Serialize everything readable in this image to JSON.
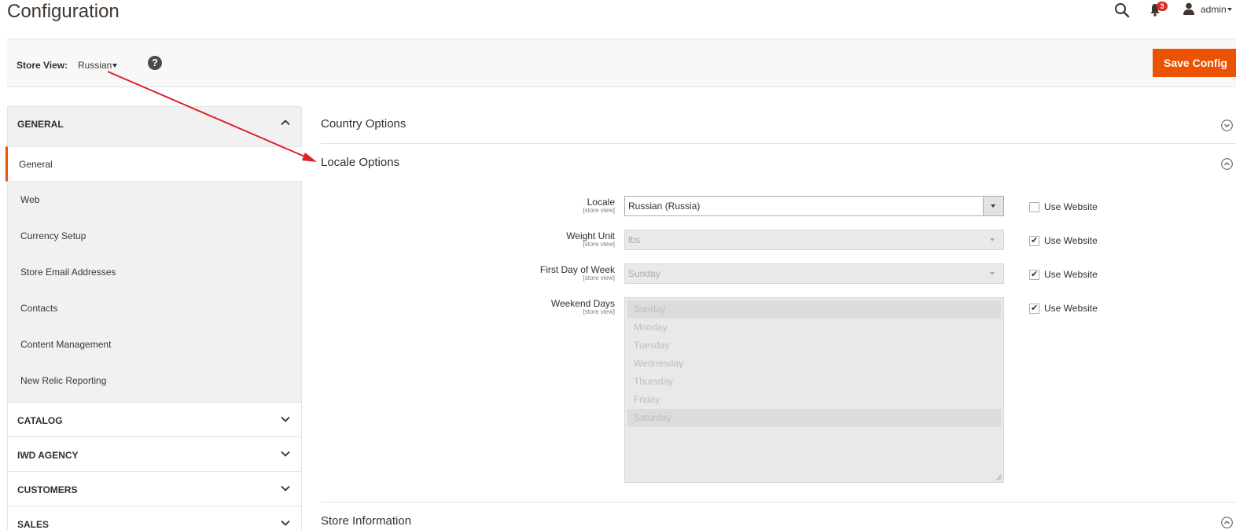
{
  "header": {
    "title": "Configuration",
    "notifications_count": "3",
    "user_name": "admin"
  },
  "store_bar": {
    "label": "Store View:",
    "selected_store": "Russian",
    "help_glyph": "?",
    "save_label": "Save Config"
  },
  "sidebar": {
    "general_section": {
      "title": "GENERAL",
      "items": [
        {
          "label": "General",
          "active": true
        },
        {
          "label": "Web"
        },
        {
          "label": "Currency Setup"
        },
        {
          "label": "Store Email Addresses"
        },
        {
          "label": "Contacts"
        },
        {
          "label": "Content Management"
        },
        {
          "label": "New Relic Reporting"
        }
      ]
    },
    "collapsed_sections": [
      "CATALOG",
      "IWD AGENCY",
      "CUSTOMERS",
      "SALES"
    ]
  },
  "main": {
    "groups": [
      {
        "title": "Country Options",
        "expanded": false
      },
      {
        "title": "Locale Options",
        "expanded": true
      },
      {
        "title": "Store Information",
        "expanded": true
      }
    ],
    "locale_fields": {
      "scope_text": "[store view]",
      "use_website_label": "Use Website",
      "locale": {
        "label": "Locale",
        "value": "Russian (Russia)",
        "use_website": false
      },
      "weight_unit": {
        "label": "Weight Unit",
        "value": "lbs",
        "use_website": true
      },
      "first_day": {
        "label": "First Day of Week",
        "value": "Sunday",
        "use_website": true
      },
      "weekend_days": {
        "label": "Weekend Days",
        "options": [
          "Sunday",
          "Monday",
          "Tuesday",
          "Wednesday",
          "Thursday",
          "Friday",
          "Saturday"
        ],
        "selected": [
          "Sunday",
          "Saturday"
        ],
        "use_website": true
      }
    }
  },
  "annotation": {
    "color": "#e31e24"
  },
  "colors": {
    "accent": "#eb5202",
    "badge": "#e22626"
  }
}
